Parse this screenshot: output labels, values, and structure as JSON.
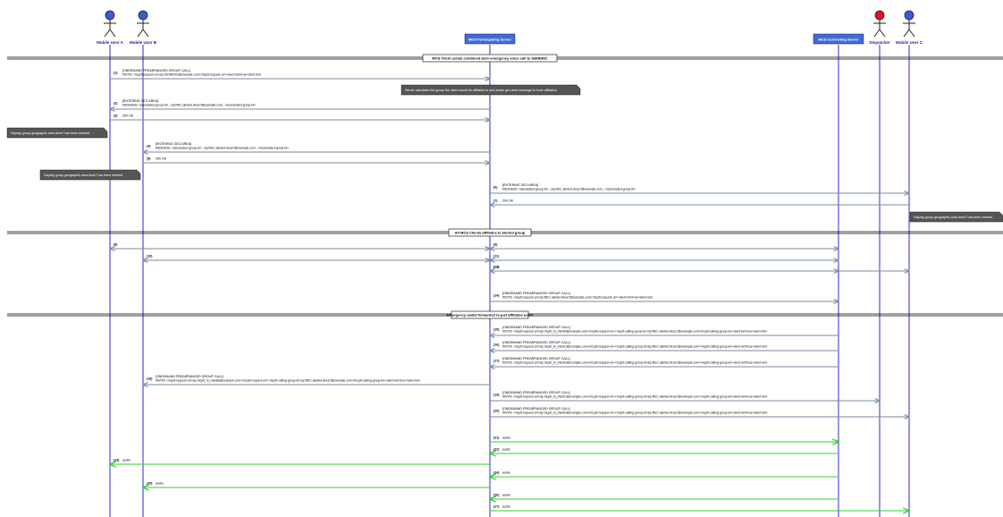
{
  "colors": {
    "lifeline": "#2b2bd6",
    "actor_blue": "#3b5bdb",
    "actor_red": "#e0102e",
    "server_box": "#3f6bd9",
    "server_box_text": "#ffffff",
    "signal": "#7a8aa0",
    "audio": "#33cc33",
    "note_bg": "#555555",
    "note_text": "#ffffff",
    "divider": "#000000"
  },
  "participants": [
    {
      "id": "A",
      "label": "Mobile User A",
      "kind": "actor",
      "icon": "actor-icon",
      "color": "blue"
    },
    {
      "id": "B",
      "label": "Mobile User B",
      "kind": "actor",
      "icon": "actor-icon",
      "color": "blue"
    },
    {
      "id": "P",
      "label": "MCS Participating Server",
      "kind": "box"
    },
    {
      "id": "C",
      "label": "MCS Controlling Server",
      "kind": "box"
    },
    {
      "id": "D",
      "label": "Dispatcher",
      "kind": "actor",
      "icon": "actor-icon",
      "color": "red"
    },
    {
      "id": "U",
      "label": "Mobile User C",
      "kind": "actor",
      "icon": "actor-icon",
      "color": "blue"
    }
  ],
  "dividers": [
    "MCS Client sends combined alert-emergency voice call to GENERIC",
    "All MCS Clients affiliates to alerted group",
    "Emergency called forwarded to just affiliated users"
  ],
  "notes": [
    "Server calculates the group the users would be affiliated to and sends geo-area message to force affiliation",
    "Display group geographic area Area7 has been entered",
    "Display group geographic area Area7 has been entered",
    "Display group geographic area Area7 has been entered"
  ],
  "messages": [
    {
      "num": "(1)",
      "text": "[ONDEMAND PREARRANGED GROUP CALL]",
      "text2": "INVITE <mcptt-request-uri>sip:GENERIC@example.com</mcptt-request-uri><alert-ind>true</alert-ind>"
    },
    {
      "num": "(2)",
      "text": "[ENTERING GEO AREA]",
      "text2": "MESSAGE <associated-group-id>...sip:REC.alerted.Area7@example.com...</associated-group-id>"
    },
    {
      "num": "(3)",
      "text": "200 OK"
    },
    {
      "num": "(4)",
      "text": "[ENTERING GEO AREA]",
      "text2": "MESSAGE <associated-group-id>...sip:REC.alerted.Area7@example.com...</associated-group-id>"
    },
    {
      "num": "(5)",
      "text": "200 OK"
    },
    {
      "num": "(6)",
      "text": "[ENTERING GEO AREA]",
      "text2": "MESSAGE <associated-group-id>...sip:REC.alerted.Area7@example.com...</associated-group-id>"
    },
    {
      "num": "(7)",
      "text": "200 OK"
    },
    {
      "num": "(8)",
      "text": ""
    },
    {
      "num": "(9)",
      "text": ""
    },
    {
      "num": "(10)",
      "text": ""
    },
    {
      "num": "(11)",
      "text": ""
    },
    {
      "num": "(12)",
      "text": ""
    },
    {
      "num": "(13)",
      "text": ""
    },
    {
      "num": "(14)",
      "text": "[ONDEMAND PREARRANGED GROUP CALL]",
      "text2": "INVITE <mcptt-request-uri>sip:REC.alerted.Area7@example.com</mcptt-request-uri><alert-ind>true</alert-ind>"
    },
    {
      "num": "(15)",
      "text": "[ONDEMAND PREARRANGED GROUP CALL]",
      "text2": "INVITE <mcptt-request-uri>sip:mcptt_id_clientB@example.com</mcptt-request-uri><mcptt-calling-group-id>sip:REC.alerted.Area7@example.com</mcptt-calling-group-id><alert-ind>true</alert-ind>"
    },
    {
      "num": "(16)",
      "text": "[ONDEMAND PREARRANGED GROUP CALL]",
      "text2": "INVITE <mcptt-request-uri>sip:mcptt_id_clientC@example.com</mcptt-request-uri><mcptt-calling-group-id>sip:REC.alerted.Area7@example.com</mcptt-calling-group-id><alert-ind>true</alert-ind>"
    },
    {
      "num": "(17)",
      "text": "[ONDEMAND PREARRANGED GROUP CALL]",
      "text2": "INVITE <mcptt-request-uri>sip:mcptt_id_clientD@example.com</mcptt-request-uri><mcptt-calling-group-id>sip:REC.alerted.Area7@example.com</mcptt-calling-group-id><alert-ind>true</alert-ind>"
    },
    {
      "num": "(18)",
      "text": "[ONDEMAND PREARRANGED GROUP CALL]",
      "text2": "INVITE <mcptt-request-uri>sip:mcptt_id_clientB@example.com</mcptt-request-uri><mcptt-calling-group-id>sip:REC.alerted.Area7@example.com</mcptt-calling-group-id><alert-ind>true</alert-ind>"
    },
    {
      "num": "(19)",
      "text": "[ONDEMAND PREARRANGED GROUP CALL]",
      "text2": "INVITE <mcptt-request-uri>sip:mcptt_id_clientC@example.com</mcptt-request-uri><mcptt-calling-group-id>sip:REC.alerted.Area7@example.com</mcptt-calling-group-id><alert-ind>true</alert-ind>"
    },
    {
      "num": "(20)",
      "text": "[ONDEMAND PREARRANGED GROUP CALL]",
      "text2": "INVITE <mcptt-request-uri>sip:mcptt_id_clientD@example.com</mcptt-request-uri><mcptt-calling-group-id>sip:REC.alerted.Area7@example.com</mcptt-calling-group-id><alert-ind>true</alert-ind>"
    },
    {
      "num": "(21)",
      "text": "audio"
    },
    {
      "num": "(22)",
      "text": "audio"
    },
    {
      "num": "(23)",
      "text": "audio"
    },
    {
      "num": "(24)",
      "text": "audio"
    },
    {
      "num": "(25)",
      "text": "audio"
    },
    {
      "num": "(26)",
      "text": "audio"
    },
    {
      "num": "(27)",
      "text": "audio"
    }
  ]
}
